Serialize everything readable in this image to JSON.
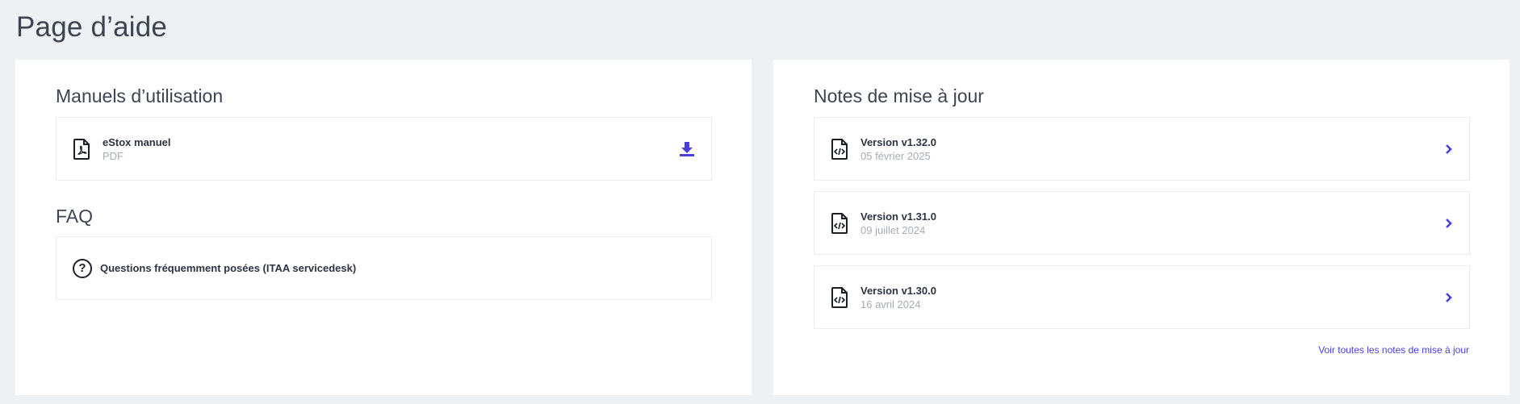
{
  "page": {
    "title": "Page d’aide"
  },
  "manuals": {
    "title": "Manuels d’utilisation",
    "items": [
      {
        "name": "eStox manuel",
        "type": "PDF",
        "icon": "pdf-file-icon",
        "action_icon": "download-icon"
      }
    ]
  },
  "faq": {
    "title": "FAQ",
    "items": [
      {
        "label": "Questions fréquemment posées (ITAA servicedesk)",
        "icon": "question-circle-icon"
      }
    ]
  },
  "release_notes": {
    "title": "Notes de mise à jour",
    "items": [
      {
        "version": "Version v1.32.0",
        "date": "05 février 2025",
        "icon": "code-file-icon",
        "action_icon": "chevron-right-icon"
      },
      {
        "version": "Version v1.31.0",
        "date": "09 juillet 2024",
        "icon": "code-file-icon",
        "action_icon": "chevron-right-icon"
      },
      {
        "version": "Version v1.30.0",
        "date": "16 avril 2024",
        "icon": "code-file-icon",
        "action_icon": "chevron-right-icon"
      }
    ],
    "see_all_label": "Voir toutes les notes de mise à jour"
  },
  "colors": {
    "accent": "#4a3fd6",
    "background": "#eef1f4",
    "card": "#ffffff"
  }
}
